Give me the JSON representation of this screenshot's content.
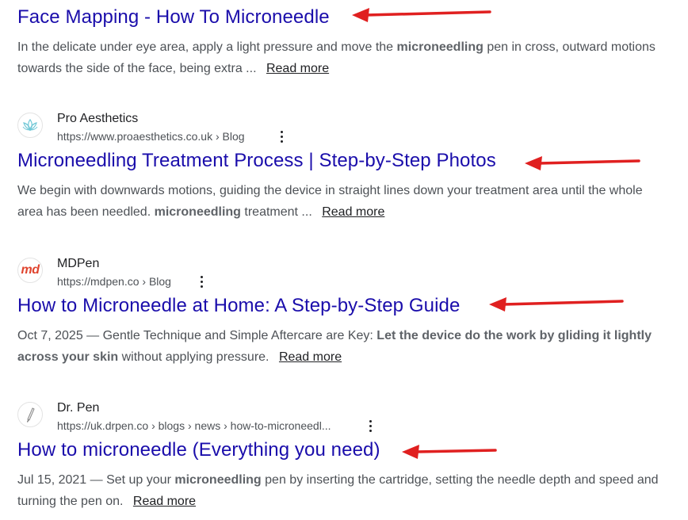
{
  "results": [
    {
      "title": "Face Mapping - How To Microneedle",
      "snippet_parts": [
        {
          "text": "In the delicate under eye area, apply a light pressure and move the ",
          "bold": false
        },
        {
          "text": "microneedling",
          "bold": true
        },
        {
          "text": " pen in cross, outward motions towards the side of the face, being extra ...",
          "bold": false
        }
      ],
      "read_more": "Read more"
    },
    {
      "site_name": "Pro Aesthetics",
      "url": "https://www.proaesthetics.co.uk › Blog",
      "favicon": "lotus-icon",
      "title": "Microneedling Treatment Process | Step-by-Step Photos",
      "snippet_parts": [
        {
          "text": "We begin with downwards motions, guiding the device in straight lines down your treatment area until the whole area has been needled. ",
          "bold": false
        },
        {
          "text": "microneedling",
          "bold": true
        },
        {
          "text": " treatment ...",
          "bold": false
        }
      ],
      "read_more": "Read more"
    },
    {
      "site_name": "MDPen",
      "url": "https://mdpen.co › Blog",
      "favicon": "md-logo-icon",
      "favicon_text": "md",
      "title": "How to Microneedle at Home: A Step-by-Step Guide",
      "snippet_parts": [
        {
          "text": "Oct 7, 2025 — Gentle Technique and Simple Aftercare are Key: ",
          "bold": false
        },
        {
          "text": "Let the device do the work by gliding it lightly across your skin",
          "bold": true
        },
        {
          "text": " without applying pressure.",
          "bold": false
        }
      ],
      "read_more": "Read more"
    },
    {
      "site_name": "Dr. Pen",
      "url": "https://uk.drpen.co › blogs › news › how-to-microneedl...",
      "favicon": "pen-icon",
      "title": "How to microneedle (Everything you need)",
      "snippet_parts": [
        {
          "text": "Jul 15, 2021 — Set up your ",
          "bold": false
        },
        {
          "text": "microneedling",
          "bold": true
        },
        {
          "text": " pen by inserting the cartridge, setting the needle depth and speed and turning the pen on.",
          "bold": false
        }
      ],
      "read_more": "Read more"
    }
  ],
  "colors": {
    "title_link": "#1a0dab",
    "annotation_arrow": "#e02020",
    "snippet_text": "#4d5156"
  },
  "annotations": {
    "arrow_icon": "red-arrow-left-icon",
    "count": 4
  }
}
